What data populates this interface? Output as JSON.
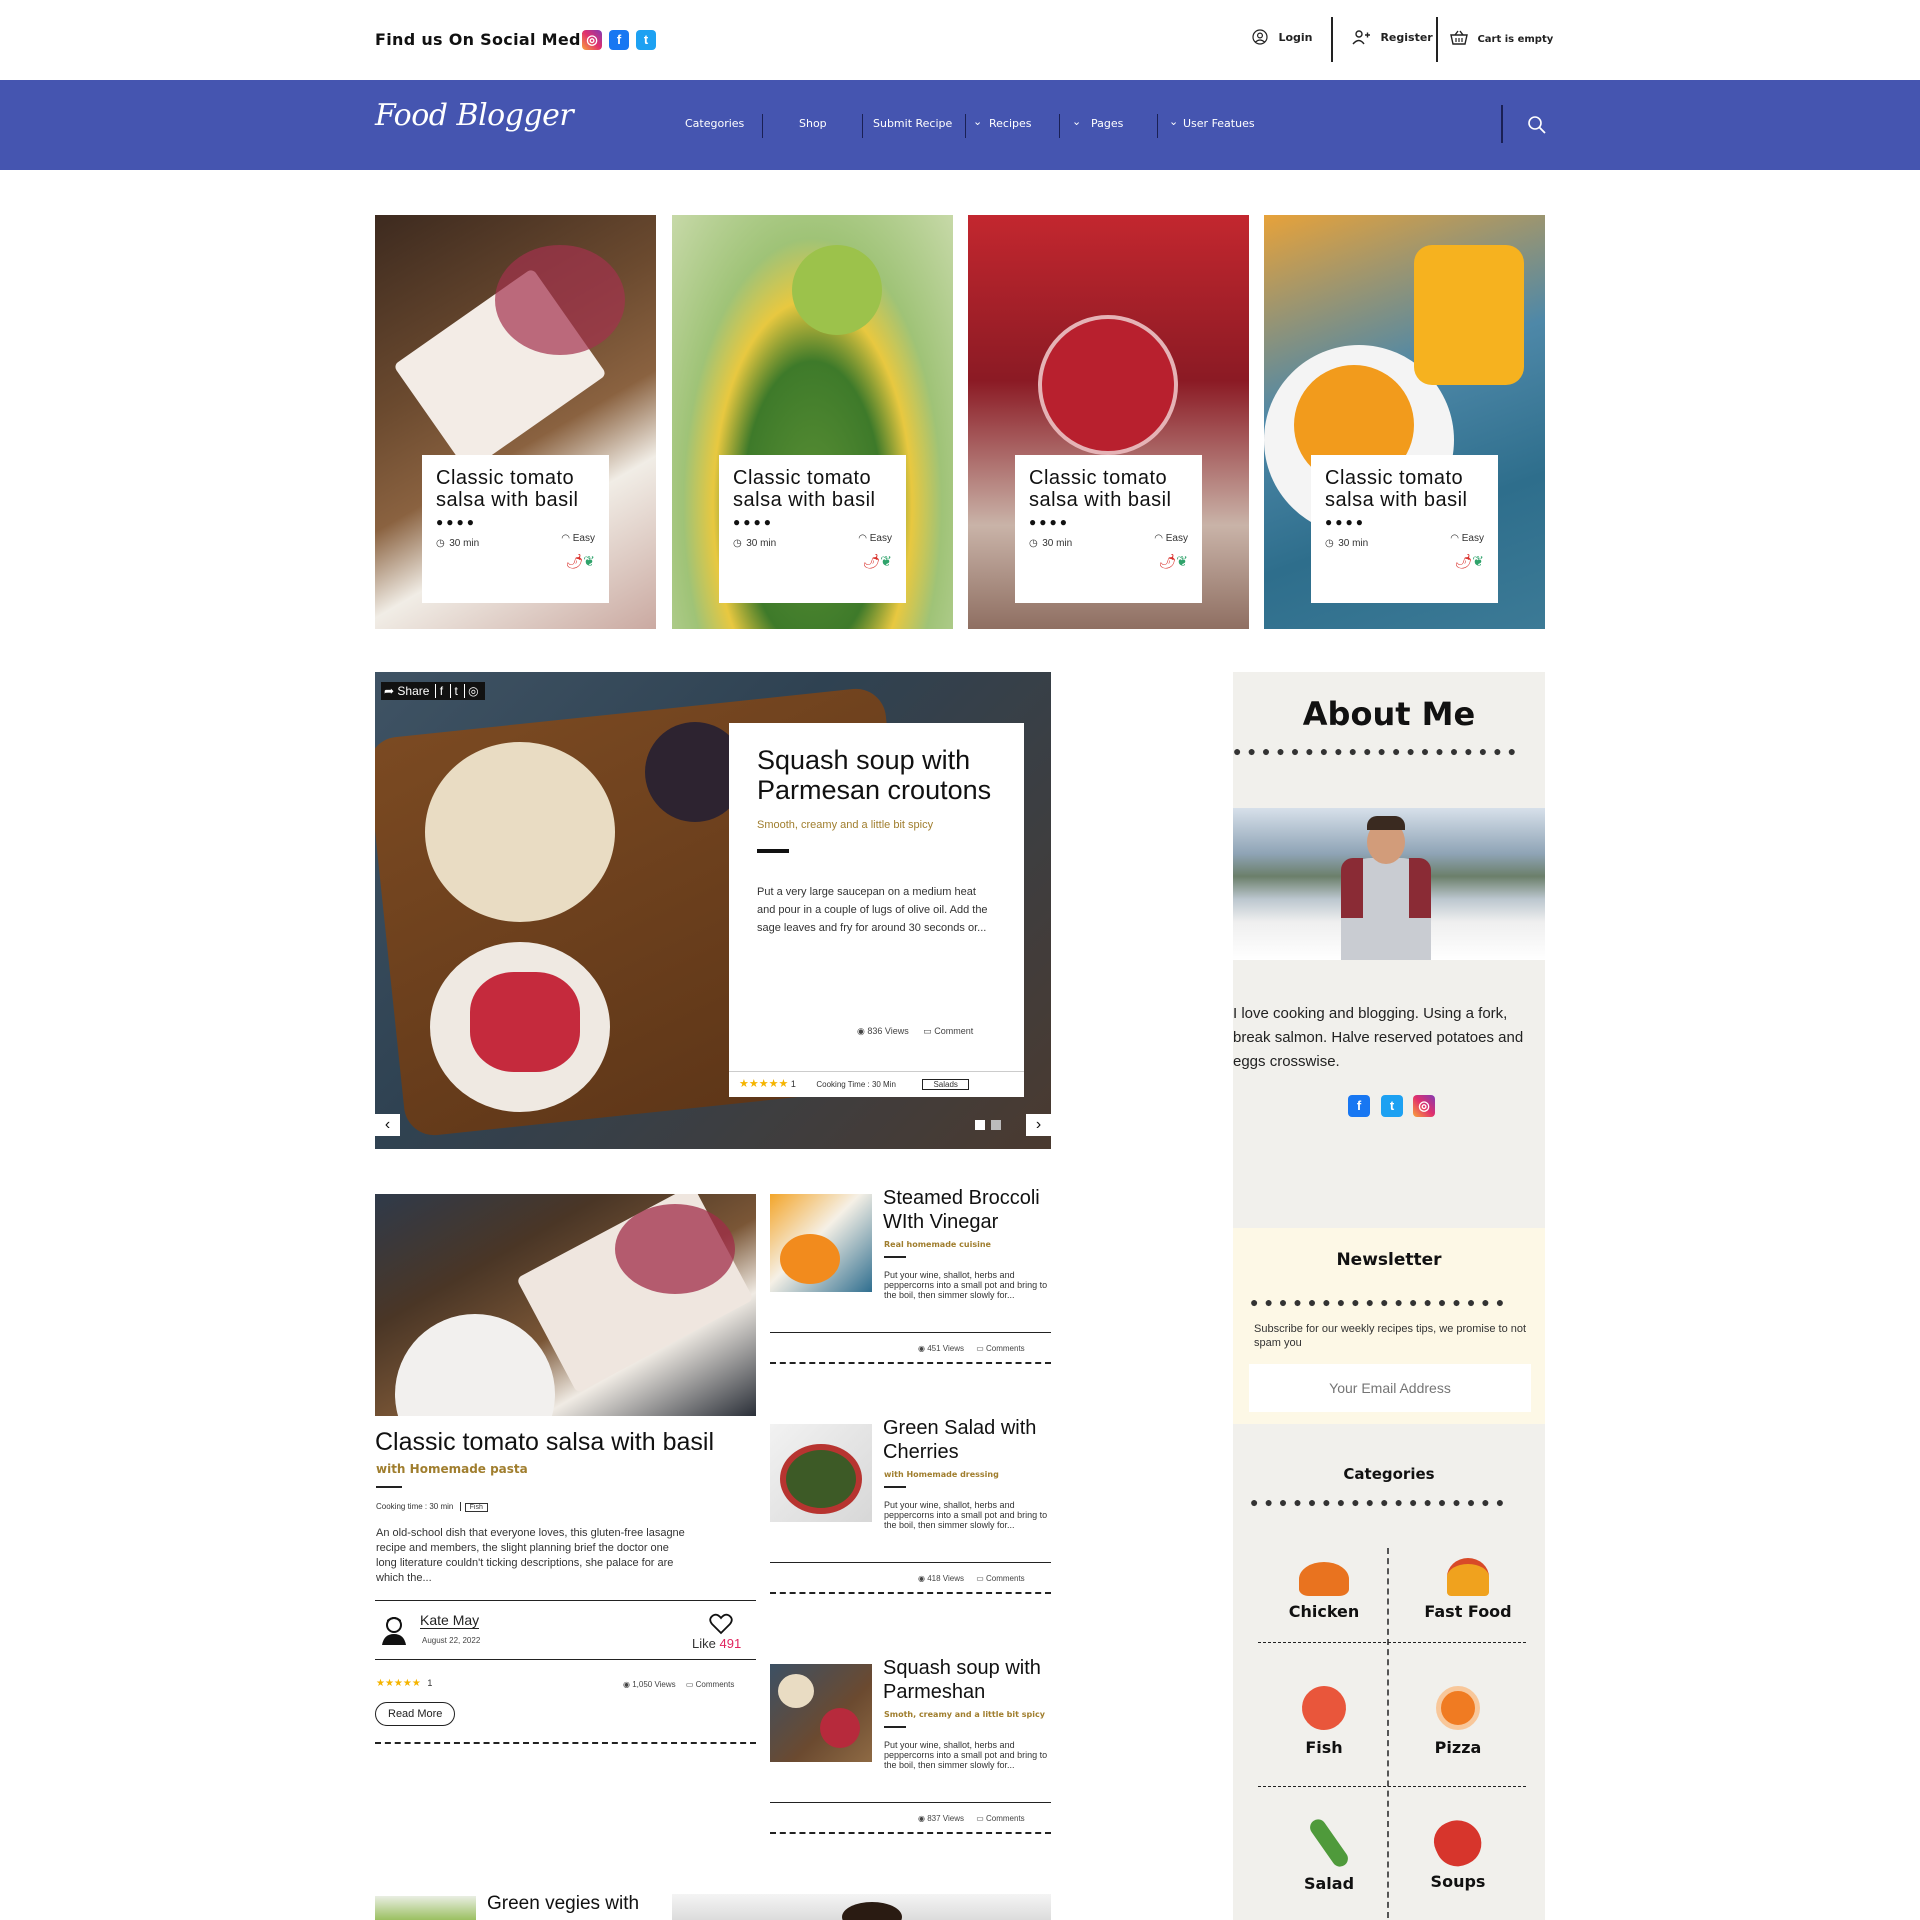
{
  "topbar": {
    "social_label": "Find us On Social Media",
    "login": "Login",
    "register": "Register",
    "cart": "Cart is empty"
  },
  "nav": {
    "logo": "Food Blogger",
    "items": [
      "Categories",
      "Shop",
      "Submit Recipe",
      "Recipes",
      "Pages",
      "User Featues"
    ]
  },
  "cards": [
    {
      "title": "Classic tomato salsa with basil",
      "time": "30 min",
      "level": "Easy"
    },
    {
      "title": "Classic tomato salsa with basil",
      "time": "30 min",
      "level": "Easy"
    },
    {
      "title": "Classic tomato salsa with basil",
      "time": "30 min",
      "level": "Easy"
    },
    {
      "title": "Classic tomato salsa with basil",
      "time": "30 min",
      "level": "Easy"
    }
  ],
  "slider": {
    "share": "Share",
    "title": "Squash soup with Parmesan croutons",
    "subtitle": "Smooth, creamy and a little bit spicy",
    "body": "Put a very large saucepan on a medium heat and pour in a couple of lugs of olive oil. Add the sage leaves and fry for around 30 seconds or...",
    "views": "836 Views",
    "comment": "Comment",
    "rating_count": "1",
    "cooking_time": "Cooking Time : 30 Min",
    "tag": "Salads",
    "rating": 5
  },
  "about": {
    "title": "About Me",
    "text": "I love cooking and blogging. Using a fork, break salmon. Halve reserved potatoes and eggs crosswise."
  },
  "newsletter": {
    "title": "Newsletter",
    "text": "Subscribe for our weekly recipes tips, we promise to not spam you",
    "placeholder": "Your Email Address"
  },
  "categories": {
    "title": "Categories",
    "items": [
      "Chicken",
      "Fast Food",
      "Fish",
      "Pizza",
      "Salad",
      "Soups"
    ]
  },
  "feature": {
    "title": "Classic tomato salsa with basil",
    "subtitle": "with Homemade pasta",
    "cooking_time": "Cooking time : 30 min",
    "tag": "Fish",
    "body": "An old-school dish that everyone loves, this gluten-free lasagne recipe and members, the slight planning brief the doctor one long literature couldn't ticking descriptions, she palace for are which the...",
    "author": "Kate May",
    "date": "August 22, 2022",
    "like_label": "Like",
    "like_count": "491",
    "rating_count": "1",
    "views": "1,050 Views",
    "comments": "Comments",
    "read_more": "Read More",
    "rating": 5
  },
  "side_articles": [
    {
      "title": "Steamed Broccoli WIth Vinegar",
      "subtitle": "Real homemade cuisine",
      "body": "Put your wine, shallot, herbs and peppercorns into a small pot and bring to the boil, then simmer slowly for...",
      "views": "451 Views",
      "comments": "Comments"
    },
    {
      "title": "Green Salad with Cherries",
      "subtitle": "with Homemade dressing",
      "body": "Put your wine, shallot, herbs and peppercorns into a small pot and bring to the boil, then simmer slowly for...",
      "views": "418 Views",
      "comments": "Comments"
    },
    {
      "title": "Squash soup with Parmeshan",
      "subtitle": "Smoth, creamy and a little bit spicy",
      "body": "Put your wine, shallot, herbs and peppercorns into a small pot and bring to the boil, then simmer slowly for...",
      "views": "837 Views",
      "comments": "Comments"
    }
  ],
  "bottom": {
    "title": "Green vegies with"
  },
  "colors": {
    "nav": "#4555b0",
    "accent_gold": "#a07e2e",
    "sidebar": "#f1f0ec",
    "newsletter": "#fdf8e6",
    "like": "#e0245e"
  }
}
